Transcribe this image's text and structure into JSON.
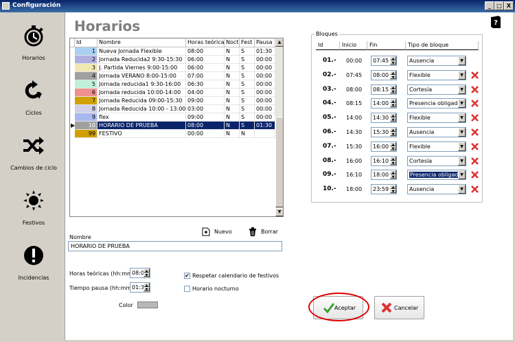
{
  "window": {
    "title": "Configuración",
    "controls": [
      "_",
      "□",
      "X"
    ]
  },
  "sidebar": {
    "items": [
      {
        "label": "Horarios",
        "icon": "stopwatch-icon"
      },
      {
        "label": "Ciclos",
        "icon": "cycle-arrow-icon"
      },
      {
        "label": "Cambios de ciclo",
        "icon": "shuffle-icon"
      },
      {
        "label": "Festivos",
        "icon": "sun-icon"
      },
      {
        "label": "Incidencias",
        "icon": "exclamation-icon"
      }
    ]
  },
  "page": {
    "title": "Horarios",
    "help_icon": "help-book-icon"
  },
  "schedules_table": {
    "columns": [
      "Id",
      "Nombre",
      "Horas teóricas",
      "Noct",
      "Fest",
      "Pausa"
    ],
    "rows": [
      {
        "id": "1",
        "name": "Nueva Jornada Flexible",
        "hours": "08:00",
        "noct": "N",
        "fest": "S",
        "pause": "01:30",
        "color": "#a8d0f0"
      },
      {
        "id": "2",
        "name": "Jornada Reducida2 9:30-15:30",
        "hours": "06:00",
        "noct": "N",
        "fest": "S",
        "pause": "00:00",
        "color": "#b0b0e0"
      },
      {
        "id": "3",
        "name": "J. Partida Viernes 9:00-15:00",
        "hours": "06:00",
        "noct": "N",
        "fest": "S",
        "pause": "00:00",
        "color": "#f0e8b0"
      },
      {
        "id": "4",
        "name": "Jornada VERANO 8:00-15:00",
        "hours": "07:00",
        "noct": "N",
        "fest": "S",
        "pause": "00:00",
        "color": "#a0a0a0"
      },
      {
        "id": "5",
        "name": "Jornada reducida1 9:30-16:00",
        "hours": "06:30",
        "noct": "N",
        "fest": "S",
        "pause": "00:00",
        "color": "#c0f0d8"
      },
      {
        "id": "6",
        "name": "Jornada reducida 10:00-14:00",
        "hours": "04:00",
        "noct": "N",
        "fest": "S",
        "pause": "00:00",
        "color": "#f09090"
      },
      {
        "id": "7",
        "name": "Jornada Reducida 09:00-15:30",
        "hours": "09:00",
        "noct": "N",
        "fest": "S",
        "pause": "00:00",
        "color": "#d0a000"
      },
      {
        "id": "8",
        "name": "Jornada Reducida 10:00 - 13:00",
        "hours": "03:00",
        "noct": "N",
        "fest": "S",
        "pause": "00:00",
        "color": "#d0d0e8"
      },
      {
        "id": "9",
        "name": "flex",
        "hours": "09:00",
        "noct": "N",
        "fest": "S",
        "pause": "00:00",
        "color": "#a8b8f0"
      },
      {
        "id": "10",
        "name": "HORARIO DE PRUEBA",
        "hours": "08:00",
        "noct": "N",
        "fest": "S",
        "pause": "01:30",
        "color": "#a0a0a0",
        "selected": true
      },
      {
        "id": "99",
        "name": "FESTIVO",
        "hours": "00:00",
        "noct": "N",
        "fest": "N",
        "pause": "",
        "color": "#d0a000"
      }
    ],
    "current_row_marker": "▶"
  },
  "toolbar": {
    "new_label": "Nuevo",
    "delete_label": "Borrar"
  },
  "form": {
    "name_label": "Nombre",
    "name_value": "HORARIO DE PRUEBA",
    "hours_label": "Horas teóricas (hh:mm)",
    "hours_value": "08:00",
    "pause_label": "Tiempo pausa (hh:mm)",
    "pause_value": "01:30",
    "color_label": "Color",
    "color_value": "#b8b8b8",
    "holidays_label": "Respetar calendario de festivos",
    "holidays_checked": true,
    "holidays_mark": "✔",
    "night_label": "Horario nocturno",
    "night_checked": false
  },
  "blocks": {
    "group_title": "Bloques",
    "columns": [
      "Id",
      "Inicio",
      "Fin",
      "Tipo de bloque"
    ],
    "rows": [
      {
        "id": "01.-",
        "start": "00:00",
        "end": "07:45",
        "type": "Ausencia",
        "deletable": false
      },
      {
        "id": "02.-",
        "start": "07:45",
        "end": "08:00",
        "type": "Flexible",
        "deletable": true
      },
      {
        "id": "03.-",
        "start": "08:00",
        "end": "08:15",
        "type": "Cortesía",
        "deletable": true
      },
      {
        "id": "04.-",
        "start": "08:15",
        "end": "14:00",
        "type": "Presencia obligada",
        "deletable": true
      },
      {
        "id": "05.-",
        "start": "14:00",
        "end": "14:30",
        "type": "Flexible",
        "deletable": true
      },
      {
        "id": "06.-",
        "start": "14:30",
        "end": "15:30",
        "type": "Ausencia",
        "deletable": true
      },
      {
        "id": "07.-",
        "start": "15:30",
        "end": "16:00",
        "type": "Flexible",
        "deletable": true
      },
      {
        "id": "08.-",
        "start": "16:00",
        "end": "16:10",
        "type": "Cortesía",
        "deletable": true
      },
      {
        "id": "09.-",
        "start": "16:10",
        "end": "18:00",
        "type": "Presencia obligada",
        "deletable": true,
        "highlighted": true
      },
      {
        "id": "10.-",
        "start": "18:00",
        "end": "23:59",
        "type": "Ausencia",
        "deletable": true
      }
    ]
  },
  "actions": {
    "accept_label": "Aceptar",
    "cancel_label": "Cancelar"
  },
  "colors": {
    "selection": "#0a246a",
    "title_gray": "#7f7f7f",
    "delete_red": "#e03030",
    "accept_green": "#3aa030",
    "annotation_red": "#e00000"
  }
}
